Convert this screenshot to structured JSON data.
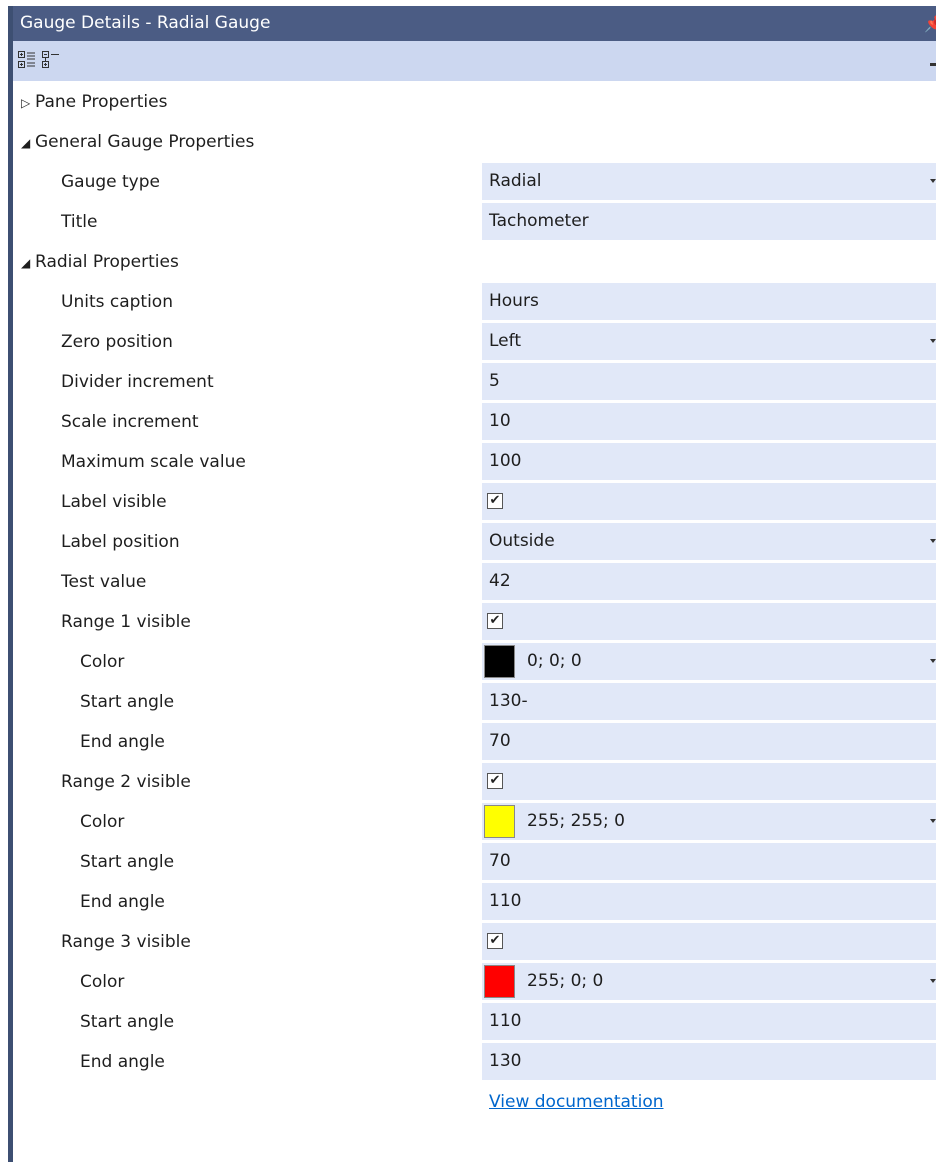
{
  "window": {
    "title": "Gauge Details - Radial Gauge"
  },
  "toolbar": {
    "categorized_icon": "categorized-view-icon",
    "alphabetical_icon": "alphabetical-view-icon"
  },
  "categories": {
    "pane": "Pane Properties",
    "general": "General Gauge Properties",
    "radial": "Radial Properties"
  },
  "general": {
    "gauge_type": {
      "label": "Gauge type",
      "value": "Radial"
    },
    "title": {
      "label": "Title",
      "value": "Tachometer"
    }
  },
  "radial": {
    "units_caption": {
      "label": "Units caption",
      "value": "Hours"
    },
    "zero_position": {
      "label": "Zero position",
      "value": "Left"
    },
    "divider_increment": {
      "label": "Divider increment",
      "value": "5"
    },
    "scale_increment": {
      "label": "Scale increment",
      "value": "10"
    },
    "max_scale": {
      "label": "Maximum scale value",
      "value": "100"
    },
    "label_visible": {
      "label": "Label visible",
      "checked": true
    },
    "label_position": {
      "label": "Label position",
      "value": "Outside"
    },
    "test_value": {
      "label": "Test value",
      "value": "42"
    }
  },
  "ranges": [
    {
      "visible_label": "Range 1 visible",
      "checked": true,
      "color_label": "Color",
      "color_value": "0; 0; 0",
      "swatch": "#000000",
      "start_label": "Start angle",
      "start_value": "130-",
      "end_label": "End angle",
      "end_value": "70"
    },
    {
      "visible_label": "Range 2 visible",
      "checked": true,
      "color_label": "Color",
      "color_value": "255; 255; 0",
      "swatch": "#ffff00",
      "start_label": "Start angle",
      "start_value": "70",
      "end_label": "End angle",
      "end_value": "110"
    },
    {
      "visible_label": "Range 3 visible",
      "checked": true,
      "color_label": "Color",
      "color_value": "255; 0; 0",
      "swatch": "#ff0000",
      "start_label": "Start angle",
      "start_value": "110",
      "end_label": "End angle",
      "end_value": "130"
    }
  ],
  "link": {
    "text": "View documentation"
  },
  "colors": {
    "titlebar": "#4b5c84",
    "toolbar": "#ccd7f0",
    "value_bg": "#e1e8f8",
    "link": "#0066cc"
  }
}
